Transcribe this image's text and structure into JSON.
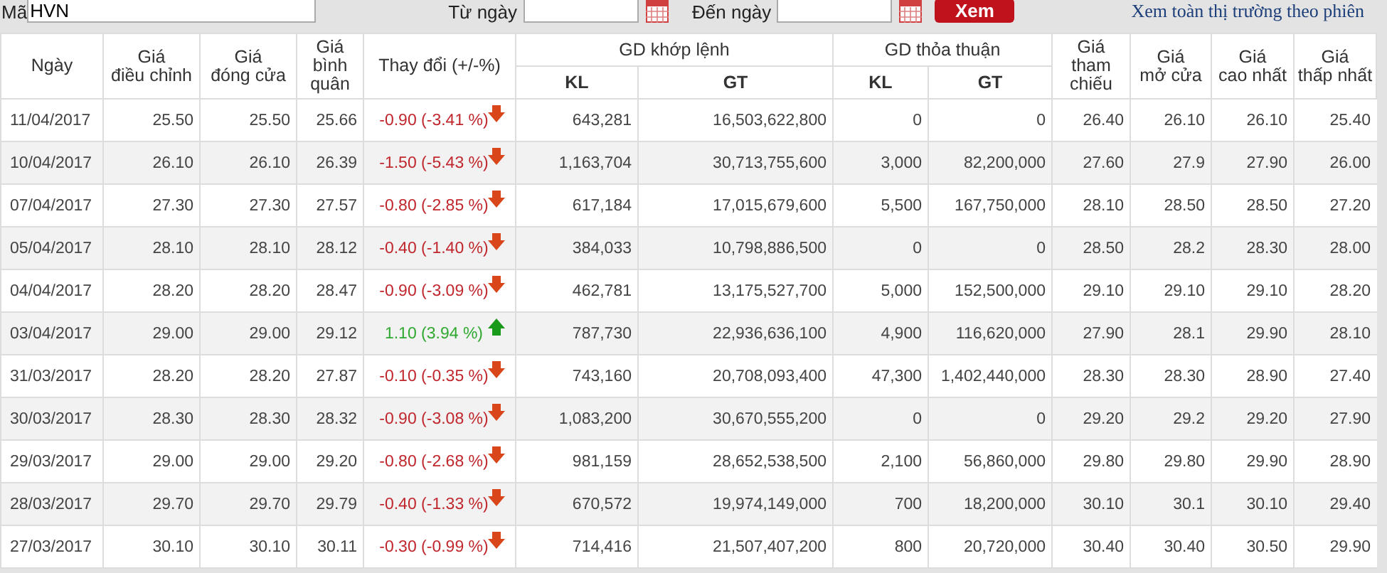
{
  "filter": {
    "code_label": "Mã",
    "code_value": "HVN",
    "from_label": "Từ ngày",
    "to_label": "Đến ngày",
    "button": "Xem",
    "link": "Xem toàn thị trường theo phiên"
  },
  "table": {
    "columns": [
      {
        "label": "Ngày"
      },
      {
        "label": "Giá\nđiều chỉnh"
      },
      {
        "label": "Giá\nđóng cửa"
      },
      {
        "label": "Giá\nbình\nquân"
      },
      {
        "label": "Thay đổi (+/-%)"
      },
      {
        "label": "GD khớp lệnh",
        "sub": [
          "KL",
          "GT"
        ]
      },
      {
        "label": "GD thỏa thuận",
        "sub": [
          "KL",
          "GT"
        ]
      },
      {
        "label": "Giá\ntham\nchiếu"
      },
      {
        "label": "Giá\nmở cửa"
      },
      {
        "label": "Giá\ncao nhất"
      },
      {
        "label": "Giá\nthấp nhất"
      }
    ],
    "rows": [
      {
        "date": "11/04/2017",
        "adj": "25.50",
        "close": "25.50",
        "avg": "25.66",
        "change": "-0.90 (-3.41 %)",
        "rising": false,
        "kl": "643,281",
        "gt": "16,503,622,800",
        "kl2": "0",
        "gt2": "0",
        "ref": "26.40",
        "open": "26.10",
        "high": "26.10",
        "low": "25.40"
      },
      {
        "date": "10/04/2017",
        "adj": "26.10",
        "close": "26.10",
        "avg": "26.39",
        "change": "-1.50 (-5.43 %)",
        "rising": false,
        "kl": "1,163,704",
        "gt": "30,713,755,600",
        "kl2": "3,000",
        "gt2": "82,200,000",
        "ref": "27.60",
        "open": "27.9",
        "high": "27.90",
        "low": "26.00"
      },
      {
        "date": "07/04/2017",
        "adj": "27.30",
        "close": "27.30",
        "avg": "27.57",
        "change": "-0.80 (-2.85 %)",
        "rising": false,
        "kl": "617,184",
        "gt": "17,015,679,600",
        "kl2": "5,500",
        "gt2": "167,750,000",
        "ref": "28.10",
        "open": "28.50",
        "high": "28.50",
        "low": "27.20"
      },
      {
        "date": "05/04/2017",
        "adj": "28.10",
        "close": "28.10",
        "avg": "28.12",
        "change": "-0.40 (-1.40 %)",
        "rising": false,
        "kl": "384,033",
        "gt": "10,798,886,500",
        "kl2": "0",
        "gt2": "0",
        "ref": "28.50",
        "open": "28.2",
        "high": "28.30",
        "low": "28.00"
      },
      {
        "date": "04/04/2017",
        "adj": "28.20",
        "close": "28.20",
        "avg": "28.47",
        "change": "-0.90 (-3.09 %)",
        "rising": false,
        "kl": "462,781",
        "gt": "13,175,527,700",
        "kl2": "5,000",
        "gt2": "152,500,000",
        "ref": "29.10",
        "open": "29.10",
        "high": "29.10",
        "low": "28.20"
      },
      {
        "date": "03/04/2017",
        "adj": "29.00",
        "close": "29.00",
        "avg": "29.12",
        "change": "1.10 (3.94 %)",
        "rising": true,
        "kl": "787,730",
        "gt": "22,936,636,100",
        "kl2": "4,900",
        "gt2": "116,620,000",
        "ref": "27.90",
        "open": "28.1",
        "high": "29.90",
        "low": "28.10"
      },
      {
        "date": "31/03/2017",
        "adj": "28.20",
        "close": "28.20",
        "avg": "27.87",
        "change": "-0.10 (-0.35 %)",
        "rising": false,
        "kl": "743,160",
        "gt": "20,708,093,400",
        "kl2": "47,300",
        "gt2": "1,402,440,000",
        "ref": "28.30",
        "open": "28.30",
        "high": "28.90",
        "low": "27.40"
      },
      {
        "date": "30/03/2017",
        "adj": "28.30",
        "close": "28.30",
        "avg": "28.32",
        "change": "-0.90 (-3.08 %)",
        "rising": false,
        "kl": "1,083,200",
        "gt": "30,670,555,200",
        "kl2": "0",
        "gt2": "0",
        "ref": "29.20",
        "open": "29.2",
        "high": "29.20",
        "low": "27.90"
      },
      {
        "date": "29/03/2017",
        "adj": "29.00",
        "close": "29.00",
        "avg": "29.20",
        "change": "-0.80 (-2.68 %)",
        "rising": false,
        "kl": "981,159",
        "gt": "28,652,538,500",
        "kl2": "2,100",
        "gt2": "56,860,000",
        "ref": "29.80",
        "open": "29.80",
        "high": "29.90",
        "low": "28.90"
      },
      {
        "date": "28/03/2017",
        "adj": "29.70",
        "close": "29.70",
        "avg": "29.79",
        "change": "-0.40 (-1.33 %)",
        "rising": false,
        "kl": "670,572",
        "gt": "19,974,149,000",
        "kl2": "700",
        "gt2": "18,200,000",
        "ref": "30.10",
        "open": "30.1",
        "high": "30.10",
        "low": "29.40"
      },
      {
        "date": "27/03/2017",
        "adj": "30.10",
        "close": "30.10",
        "avg": "30.11",
        "change": "-0.30 (-0.99 %)",
        "rising": false,
        "kl": "714,416",
        "gt": "21,507,407,200",
        "kl2": "800",
        "gt2": "20,720,000",
        "ref": "30.40",
        "open": "30.40",
        "high": "30.50",
        "low": "29.90"
      }
    ]
  }
}
